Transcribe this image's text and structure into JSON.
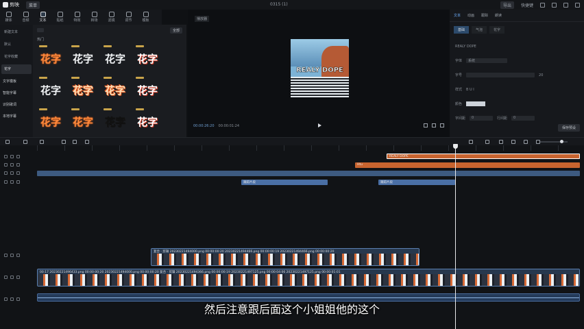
{
  "window": {
    "app_name": "剪映",
    "menu_label": "菜单",
    "title": "0315 (1)",
    "right_items": [
      "导出",
      "快捷键",
      "1"
    ]
  },
  "toolbar": {
    "tools": [
      {
        "label": "媒体",
        "icon": "media-icon"
      },
      {
        "label": "音频",
        "icon": "audio-icon"
      },
      {
        "label": "文本",
        "icon": "text-icon",
        "active": true
      },
      {
        "label": "贴纸",
        "icon": "sticker-icon"
      },
      {
        "label": "特效",
        "icon": "effects-icon"
      },
      {
        "label": "转场",
        "icon": "transition-icon"
      },
      {
        "label": "滤镜",
        "icon": "filter-icon"
      },
      {
        "label": "调节",
        "icon": "adjust-icon"
      },
      {
        "label": "模板",
        "icon": "template-icon"
      }
    ]
  },
  "sidebar": {
    "items": [
      {
        "label": "新建文本",
        "active": false
      },
      {
        "label": "默认",
        "active": false
      },
      {
        "label": "花字收藏",
        "active": false
      },
      {
        "label": "花字",
        "active": true
      }
    ],
    "groups": [
      "文字模板",
      "智能字幕",
      "识别歌词",
      "本地字幕"
    ]
  },
  "assets": {
    "filter_label": "全部",
    "section_label": "热门",
    "tiles": [
      {
        "text": "花字",
        "style": "o"
      },
      {
        "text": "花字",
        "style": "w"
      },
      {
        "text": "花字",
        "style": "w"
      },
      {
        "text": "花字",
        "style": "r"
      },
      {
        "text": "花字",
        "style": "w"
      },
      {
        "text": "花字",
        "style": "ob"
      },
      {
        "text": "花字",
        "style": "ob"
      },
      {
        "text": "花字",
        "style": "r"
      },
      {
        "text": "花字",
        "style": "o"
      },
      {
        "text": "花字",
        "style": "o"
      },
      {
        "text": "花字",
        "style": "wo"
      },
      {
        "text": "花字",
        "style": "r"
      }
    ]
  },
  "preview": {
    "label": "播放器",
    "frame_text": "REALY DOPE",
    "current_time": "00:00:26:20",
    "total_time": "00:00:01:24"
  },
  "inspector": {
    "tabs": [
      "文本",
      "动画",
      "跟踪",
      "朗读"
    ],
    "subtabs": [
      "基础",
      "气泡",
      "花字"
    ],
    "text_preview": "REALY DOPE",
    "rows": [
      {
        "label": "字体",
        "value": "系统"
      },
      {
        "label": "字号",
        "value": "20"
      },
      {
        "label": "样式",
        "value": "B U I"
      },
      {
        "label": "颜色",
        "value": ""
      },
      {
        "label": "字间距",
        "value": "0"
      },
      {
        "label": "行间距",
        "value": "0"
      }
    ],
    "apply_label": "保存预设"
  },
  "timeline": {
    "text_clips": [
      {
        "label": "REALY DOPE",
        "track": 0
      },
      {
        "label": "Htu",
        "track": 1
      },
      {
        "label": "",
        "track": 2
      }
    ],
    "sticker_clips": [
      "跟踪片段",
      "跟踪片段"
    ],
    "strip_upper": "复合 · 剪辑 20230221494000.png  00:00:00:20   20230221494466.png  00:00:00:19   20230221494466.png  00:00:00:20",
    "strip_lower": "00:17  20230221496433.png  00:00:00:20   20230221494000.png  00:00:00:20   复合 · 剪辑 20230221494366.png  00:00:00:19   20230221497125.png  00:00:04:06   20230221497125.png  00:00:01:01"
  },
  "subtitle": "然后注意跟后面这个小姐姐他的这个",
  "colors": {
    "accent": "#6fb0ff",
    "clip_orange": "#c8642f",
    "clip_blue": "#4a6fa5",
    "background": "#0f1114"
  }
}
